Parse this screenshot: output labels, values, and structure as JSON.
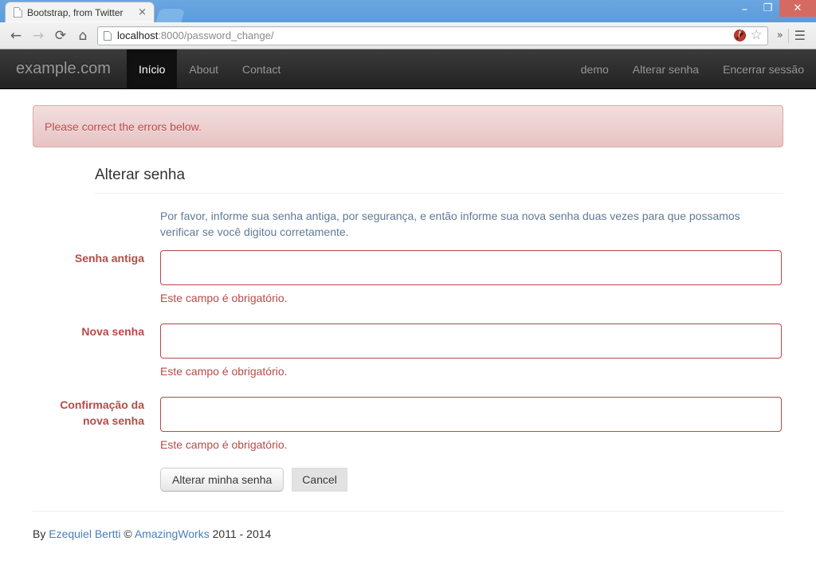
{
  "browser": {
    "tab_title": "Bootstrap, from Twitter",
    "tab_close": "×",
    "back_icon": "←",
    "forward_icon": "→",
    "reload_icon": "⟳",
    "home_icon": "⌂",
    "url_host": "localhost",
    "url_rest": ":8000/password_change/",
    "star_icon": "☆",
    "overflow_icon": "»",
    "menu_icon": "☰",
    "minimize": "–",
    "maximize": "❐",
    "close": "✕"
  },
  "navbar": {
    "brand": "example.com",
    "left_items": [
      {
        "label": "Início",
        "active": true
      },
      {
        "label": "About",
        "active": false
      },
      {
        "label": "Contact",
        "active": false
      }
    ],
    "right_items": [
      {
        "label": "demo"
      },
      {
        "label": "Alterar senha"
      },
      {
        "label": "Encerrar sessão"
      }
    ]
  },
  "alert": {
    "message": "Please correct the errors below.",
    "bg_color": "#f2dede",
    "text_color": "#b94a48",
    "border_color": "#dca7a7"
  },
  "page": {
    "title": "Alterar senha",
    "help_text": "Por favor, informe sua senha antiga, por segurança, e então informe sua nova senha duas vezes para que possamos verificar se você digitou corretamente."
  },
  "form": {
    "fields": [
      {
        "label": "Senha antiga",
        "value": "",
        "error": "Este campo é obrigatório."
      },
      {
        "label": "Nova senha",
        "value": "",
        "error": "Este campo é obrigatório."
      },
      {
        "label": "Confirmação da nova senha",
        "value": "",
        "error": "Este campo é obrigatório."
      }
    ],
    "submit_label": "Alterar minha senha",
    "cancel_label": "Cancel",
    "error_color": "#b94a48"
  },
  "footer": {
    "prefix": "By ",
    "author": "Ezequiel Bertti",
    "middle": " © ",
    "company": "AmazingWorks",
    "years": " 2011 - 2014",
    "link_color": "#4a7ebb"
  }
}
